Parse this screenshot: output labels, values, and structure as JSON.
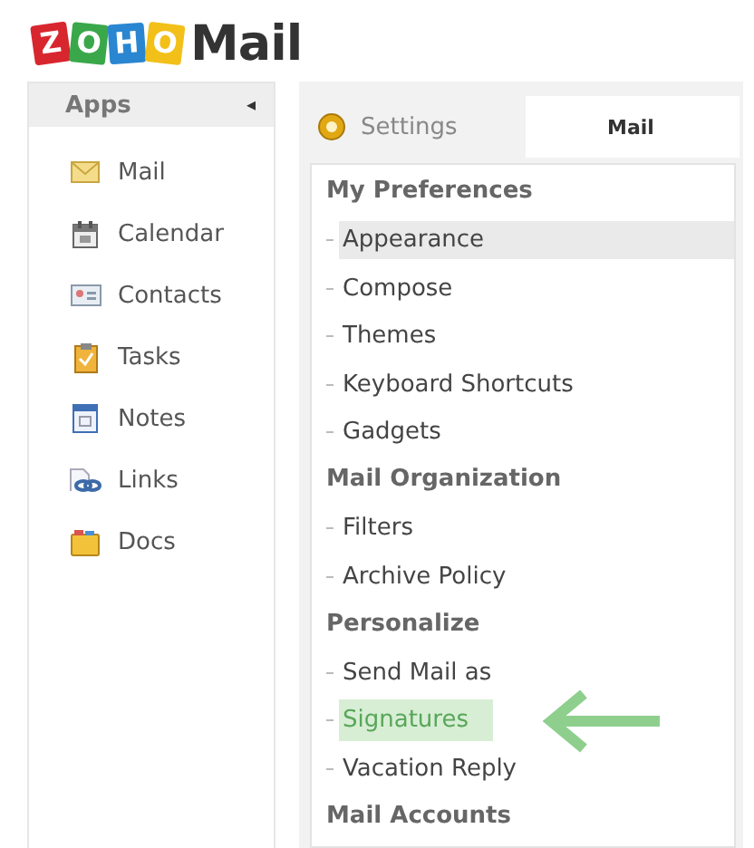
{
  "logo": {
    "letters": [
      {
        "text": "Z",
        "color": "#d8262e"
      },
      {
        "text": "O",
        "color": "#3aa84a"
      },
      {
        "text": "H",
        "color": "#2a86d0"
      },
      {
        "text": "O",
        "color": "#f2c019"
      }
    ],
    "product": "Mail"
  },
  "apps": {
    "title": "Apps",
    "collapse": "◂",
    "items": [
      {
        "label": "Mail",
        "kind": "mail"
      },
      {
        "label": "Calendar",
        "kind": "calendar"
      },
      {
        "label": "Contacts",
        "kind": "contacts"
      },
      {
        "label": "Tasks",
        "kind": "tasks"
      },
      {
        "label": "Notes",
        "kind": "notes"
      },
      {
        "label": "Links",
        "kind": "links"
      },
      {
        "label": "Docs",
        "kind": "docs"
      }
    ]
  },
  "tabs": [
    {
      "label": "Settings",
      "kind": "settings",
      "selected": false
    },
    {
      "label": "Mail",
      "kind": "plain",
      "selected": true
    }
  ],
  "sections": [
    {
      "title": "My Preferences",
      "items": [
        {
          "label": "Appearance",
          "hovered": true,
          "selected": false
        },
        {
          "label": "Compose",
          "hovered": false,
          "selected": false
        },
        {
          "label": "Themes",
          "hovered": false,
          "selected": false
        },
        {
          "label": "Keyboard Shortcuts",
          "hovered": false,
          "selected": false
        },
        {
          "label": "Gadgets",
          "hovered": false,
          "selected": false
        }
      ]
    },
    {
      "title": "Mail Organization",
      "items": [
        {
          "label": "Filters",
          "hovered": false,
          "selected": false
        },
        {
          "label": "Archive Policy",
          "hovered": false,
          "selected": false
        }
      ]
    },
    {
      "title": "Personalize",
      "items": [
        {
          "label": "Send Mail as",
          "hovered": false,
          "selected": false
        },
        {
          "label": "Signatures",
          "hovered": false,
          "selected": true,
          "pointer": true
        },
        {
          "label": "Vacation Reply",
          "hovered": false,
          "selected": false
        }
      ]
    },
    {
      "title": "Mail Accounts"
    }
  ]
}
